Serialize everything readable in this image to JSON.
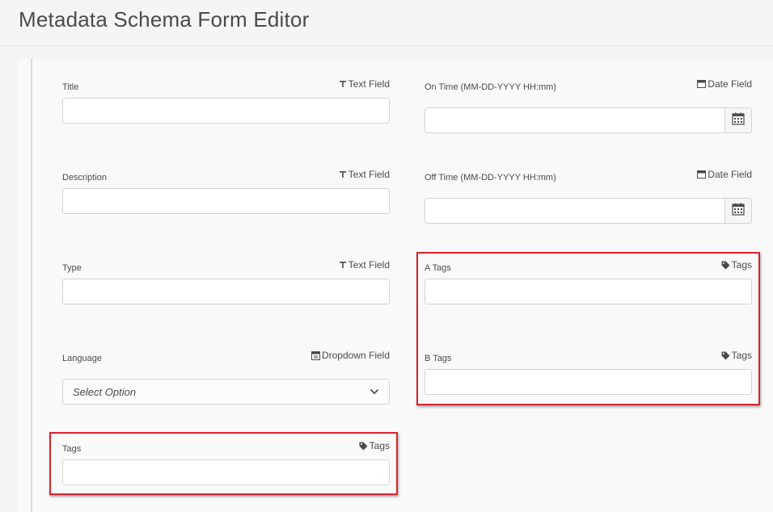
{
  "page": {
    "title": "Metadata Schema Form Editor"
  },
  "left_fields": [
    {
      "label": "Title",
      "type_label": "Text Field",
      "icon": "text-icon"
    },
    {
      "label": "Description",
      "type_label": "Text Field",
      "icon": "text-icon"
    },
    {
      "label": "Type",
      "type_label": "Text Field",
      "icon": "text-icon"
    },
    {
      "label": "Language",
      "type_label": "Dropdown Field",
      "icon": "dropdown-icon",
      "placeholder": "Select Option"
    },
    {
      "label": "Tags",
      "type_label": "Tags",
      "icon": "tag-icon"
    }
  ],
  "right_fields": [
    {
      "label": "On Time (MM-DD-YYYY HH:mm)",
      "type_label": "Date Field",
      "icon": "calendar-icon"
    },
    {
      "label": "Off Time (MM-DD-YYYY HH:mm)",
      "type_label": "Date Field",
      "icon": "calendar-icon"
    },
    {
      "label": "A Tags",
      "type_label": "Tags",
      "icon": "tag-icon"
    },
    {
      "label": "B Tags",
      "type_label": "Tags",
      "icon": "tag-icon"
    }
  ],
  "colors": {
    "highlight": "#d9232d",
    "panel": "#f9f9f9",
    "background": "#f5f5f5"
  }
}
